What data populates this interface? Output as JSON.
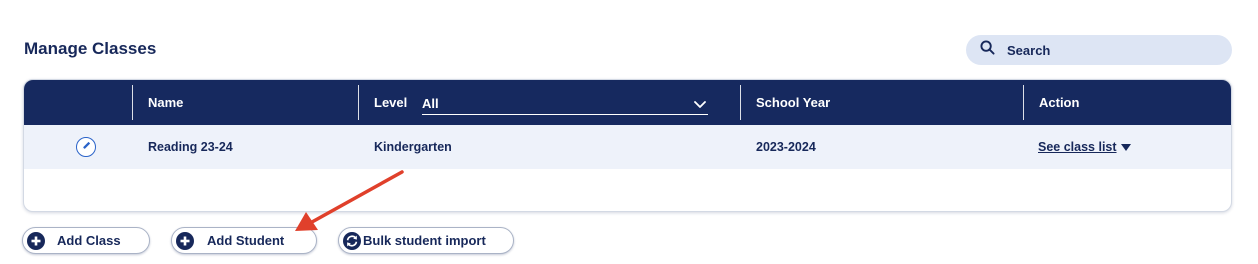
{
  "page": {
    "title": "Manage Classes"
  },
  "search": {
    "placeholder": "Search"
  },
  "table": {
    "headers": {
      "name": "Name",
      "level": "Level",
      "school_year": "School Year",
      "action": "Action"
    },
    "level_filter": {
      "selected": "All"
    },
    "rows": [
      {
        "name": "Reading 23-24",
        "level": "Kindergarten",
        "school_year": "2023-2024",
        "action": "See class list"
      }
    ]
  },
  "actions": {
    "add_class": "Add Class",
    "add_student": "Add Student",
    "bulk_import": "Bulk student import"
  },
  "icons": {
    "search": "search-icon",
    "edit": "pencil-icon",
    "level_dropdown": "chevron-down-icon",
    "row_menu": "caret-down-icon",
    "add": "plus-circle-icon",
    "import": "sync-icon",
    "annotation": "red-arrow-icon"
  },
  "colors": {
    "header_bg": "#16295f",
    "text": "#17285a",
    "row_bg": "#eef2fa",
    "search_bg": "#dde5f4",
    "edit_accent": "#2a63c9",
    "annotation_arrow": "#e0402b"
  }
}
